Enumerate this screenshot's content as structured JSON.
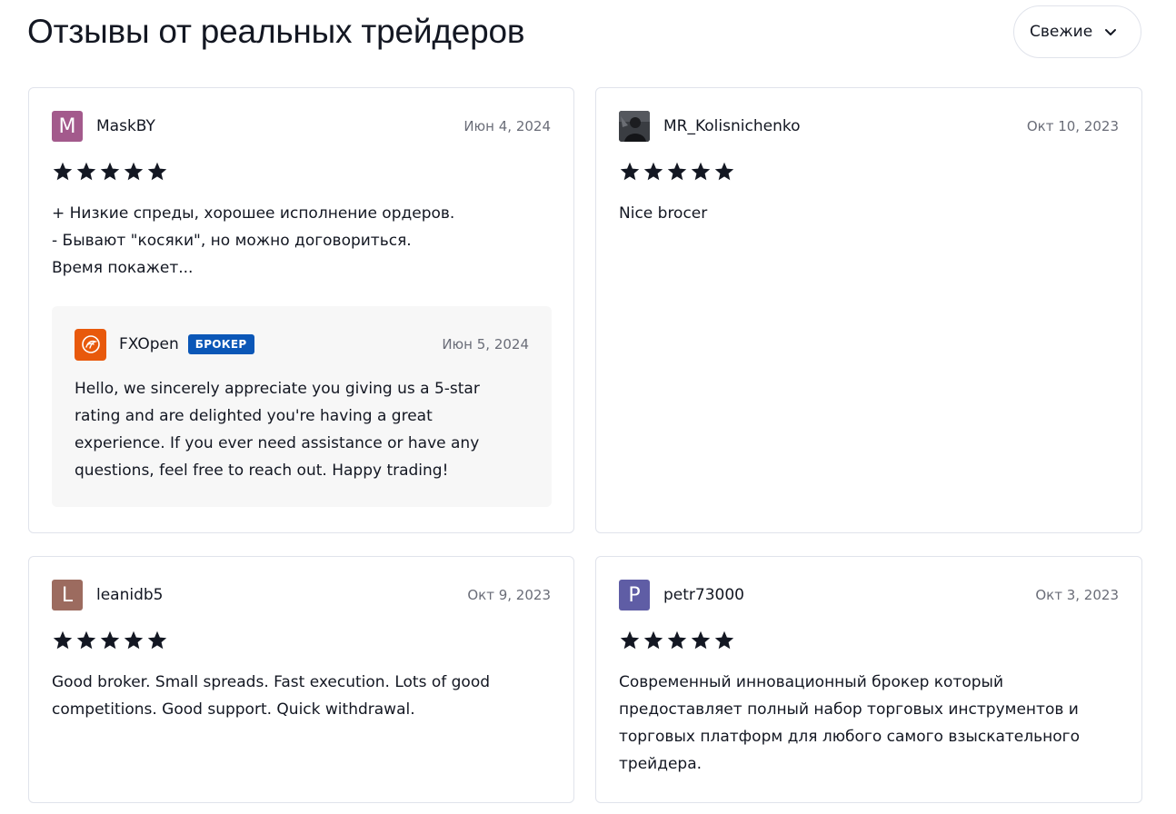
{
  "page": {
    "title": "Отзывы от реальных трейдеров",
    "sort": {
      "label": "Свежие",
      "icon": "chevron-down-icon"
    }
  },
  "colors": {
    "star": "#131722",
    "avatar_m": "#a35a8c",
    "avatar_l": "#9c6b5f",
    "avatar_p": "#5f5da5",
    "broker_logo": "#e8590c",
    "broker_badge": "#0b57b7"
  },
  "reviews": [
    {
      "author": "MaskBY",
      "avatar_letter": "M",
      "date": "Июн 4, 2024",
      "rating": 5,
      "text": "+ Низкие спреды, хорошее исполнение ордеров.\n- Бывают \"косяки\", но можно договориться.\nВремя покажет...",
      "reply": {
        "broker": "FXOpen",
        "badge": "БРОКЕР",
        "date": "Июн 5, 2024",
        "text": "Hello, we sincerely appreciate you giving us a 5-star rating and are delighted you're having a great experience. If you ever need assistance or have any questions, feel free to reach out. Happy trading!"
      }
    },
    {
      "author": "MR_Kolisnichenko",
      "avatar_letter": "",
      "date": "Окт 10, 2023",
      "rating": 5,
      "text": "Nice brocer"
    },
    {
      "author": "leanidb5",
      "avatar_letter": "L",
      "date": "Окт 9, 2023",
      "rating": 5,
      "text": "Good broker. Small spreads. Fast execution. Lots of good competitions. Good support. Quick withdrawal."
    },
    {
      "author": "petr73000",
      "avatar_letter": "P",
      "date": "Окт 3, 2023",
      "rating": 5,
      "text": "Современный инновационный брокер который предоставляет полный набор торговых инструментов и торговых платформ для любого самого взыскательного трейдера."
    }
  ]
}
